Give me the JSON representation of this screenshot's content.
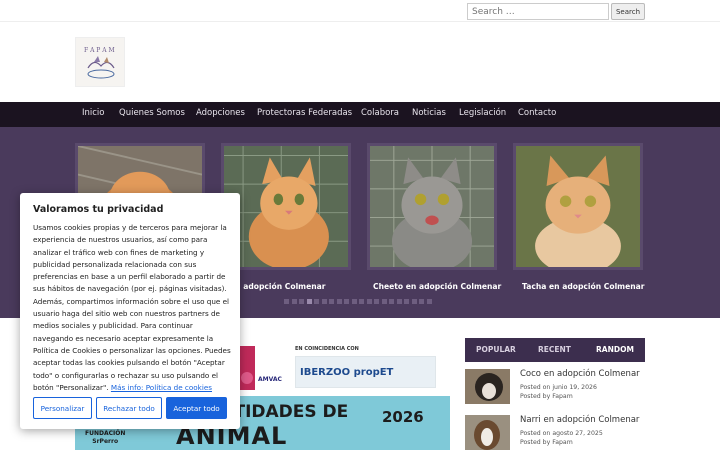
{
  "search": {
    "placeholder": "Search …",
    "button": "Search"
  },
  "nav": [
    {
      "label": "Inicio"
    },
    {
      "label": "Quienes Somos"
    },
    {
      "label": "Adopciones"
    },
    {
      "label": "Protectoras Federadas"
    },
    {
      "label": "Colabora"
    },
    {
      "label": "Noticias"
    },
    {
      "label": "Legislación"
    },
    {
      "label": "Contacto"
    }
  ],
  "slider": {
    "captions": [
      "en adopción Colmenar",
      "Cheeto en adopción Colmenar",
      "Tacha en adopción Colmenar"
    ],
    "dot_count": 20,
    "active_dot": 3
  },
  "banner": {
    "headline": "DE ENTIDADES DE",
    "headline2": "ANIMAL",
    "year": "2026",
    "org": "FUNDACIÓN\nSrPerro",
    "coincidencia": "EN COINCIDENCIA CON",
    "iberzoo": "IBERZOO propET",
    "amvac": "AMVAC"
  },
  "sidebar": {
    "tabs": [
      {
        "label": "POPULAR"
      },
      {
        "label": "RECENT"
      },
      {
        "label": "RANDOM"
      }
    ],
    "active_tab": "RANDOM",
    "posts": [
      {
        "title": "Coco en adopción Colmenar",
        "date": "Posted on junio 19, 2026",
        "author": "Posted by Fapam"
      },
      {
        "title": "Narri en adopción Colmenar",
        "date": "Posted on agosto 27, 2025",
        "author": "Posted by Fapam"
      }
    ]
  },
  "cookie": {
    "title": "Valoramos tu privacidad",
    "body": "Usamos cookies propias y de terceros para mejorar la experiencia de nuestros usuarios, así como para analizar el tráfico web con fines de marketing y publicidad personalizada relacionada con sus preferencias en base a un perfil elaborado a partir de sus hábitos de navegación (por ej. páginas visitadas). Además, compartimos información sobre el uso que el usuario haga del sitio web con nuestros partners de medios sociales y publicidad. Para continuar navegando es necesario aceptar expresamente la Política de Cookies o personalizar las opciones. Puedes aceptar todas las cookies pulsando el botón \"Aceptar todo\" o configurarlas o rechazar su uso pulsando el botón \"Personalizar\".",
    "link": "Más info: Política de cookies",
    "buttons": {
      "customize": "Personalizar",
      "reject": "Rechazar todo",
      "accept": "Aceptar todo"
    }
  },
  "colors": {
    "nav_bg": "#1b1320",
    "slider_bg": "#4a3a5c",
    "accent": "#1863dc"
  }
}
